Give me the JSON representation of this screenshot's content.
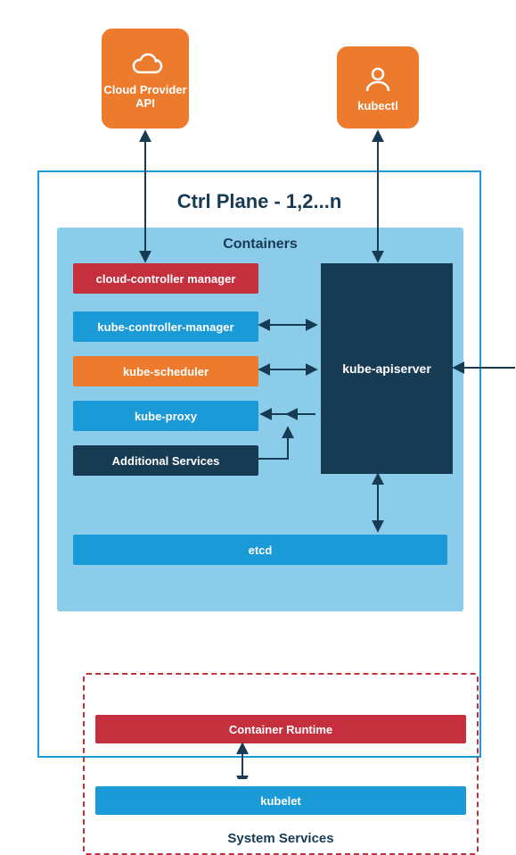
{
  "external": {
    "cloud_provider": "Cloud Provider API",
    "kubectl": "kubectl"
  },
  "ctrl_plane": {
    "title": "Ctrl Plane - 1,2...n",
    "containers_title": "Containers",
    "components": {
      "ccm": "cloud-controller manager",
      "kcm": "kube-controller-manager",
      "scheduler": "kube-scheduler",
      "proxy": "kube-proxy",
      "additional": "Additional Services",
      "apiserver": "kube-apiserver",
      "etcd": "etcd"
    },
    "container_runtime": "Container Runtime",
    "kubelet": "kubelet",
    "system_services": "System Services"
  }
}
